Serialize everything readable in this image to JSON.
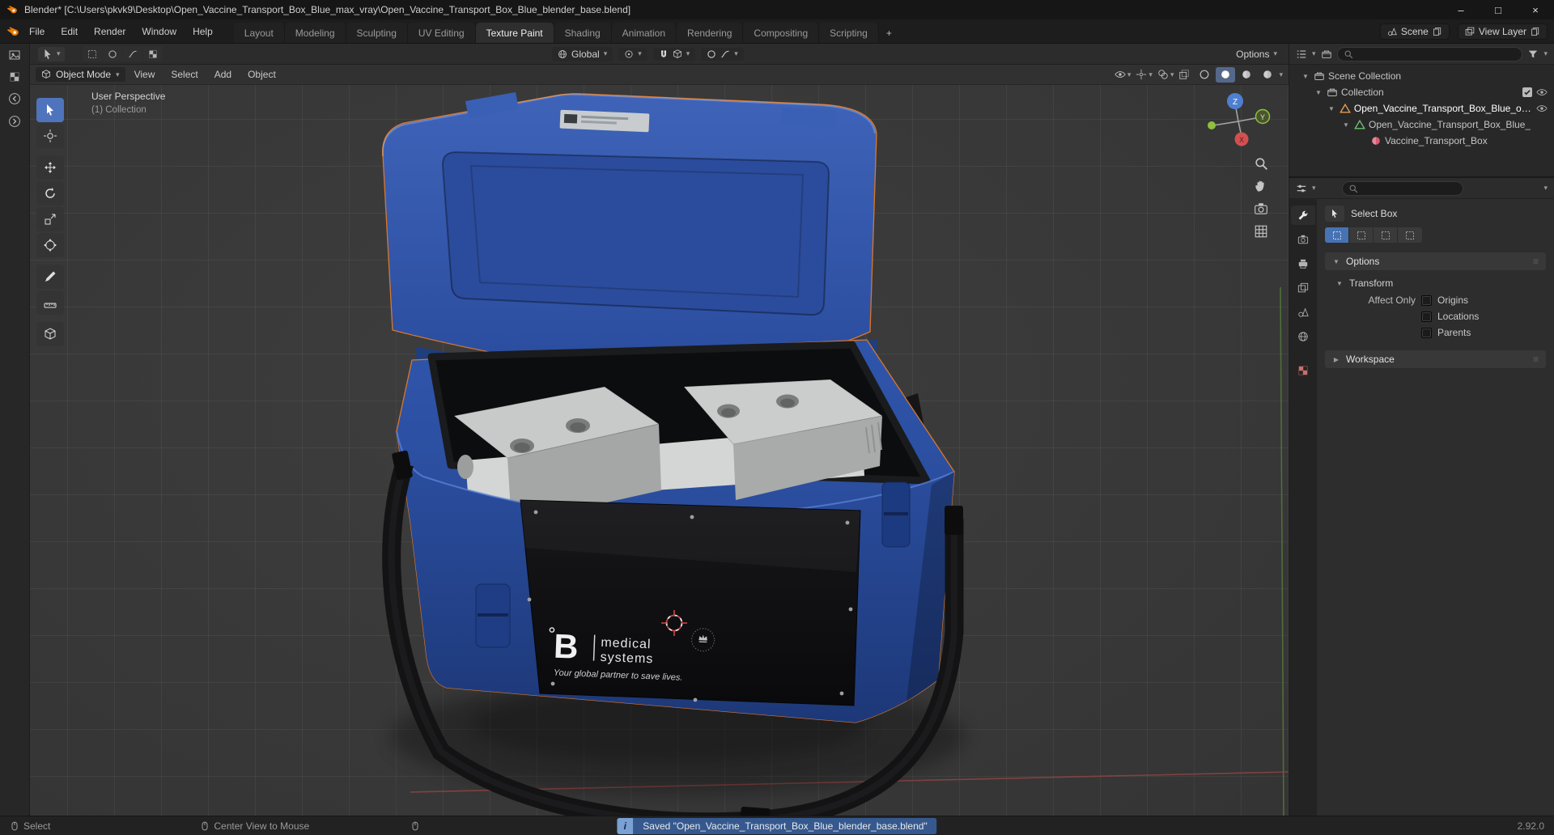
{
  "window": {
    "title": "Blender* [C:\\Users\\pkvk9\\Desktop\\Open_Vaccine_Transport_Box_Blue_max_vray\\Open_Vaccine_Transport_Box_Blue_blender_base.blend]",
    "minimize": "–",
    "maximize": "□",
    "close": "×"
  },
  "topbar": {
    "menus": [
      "File",
      "Edit",
      "Render",
      "Window",
      "Help"
    ],
    "tabs": [
      "Layout",
      "Modeling",
      "Sculpting",
      "UV Editing",
      "Texture Paint",
      "Shading",
      "Animation",
      "Rendering",
      "Compositing",
      "Scripting"
    ],
    "active_tab": "Texture Paint",
    "new_tab": "+",
    "scene": "Scene",
    "view_layer": "View Layer"
  },
  "tool_settings": {
    "orientation": "Global",
    "options": "Options"
  },
  "viewport": {
    "header": {
      "mode": "Object Mode",
      "menus": [
        "View",
        "Select",
        "Add",
        "Object"
      ]
    },
    "overlay": {
      "line1": "User Perspective",
      "line2": "(1) Collection"
    },
    "axis": {
      "x": "X",
      "y": "Y",
      "z": "Z"
    },
    "model": {
      "brand_letter": "B",
      "brand_line1": "medical",
      "brand_line2": "systems",
      "tagline": "Your global partner to save lives."
    }
  },
  "outliner": {
    "items": [
      {
        "label": "Scene Collection"
      },
      {
        "label": "Collection"
      },
      {
        "label": "Open_Vaccine_Transport_Box_Blue_obj_"
      },
      {
        "label": "Open_Vaccine_Transport_Box_Blue_"
      },
      {
        "label": "Vaccine_Transport_Box"
      }
    ]
  },
  "properties": {
    "tool_name": "Select Box",
    "panel_options": "Options",
    "panel_transform": "Transform",
    "affect_only": "Affect Only",
    "cb_origins": "Origins",
    "cb_locations": "Locations",
    "cb_parents": "Parents",
    "panel_workspace": "Workspace"
  },
  "statusbar": {
    "select": "Select",
    "center_view": "Center View to Mouse",
    "message": "Saved \"Open_Vaccine_Transport_Box_Blue_blender_base.blend\"",
    "version": "2.92.0"
  },
  "colors": {
    "accent": "#4772b3",
    "blender_orange": "#e87d0d",
    "box_blue": "#2e52a7",
    "info_blue": "#35598f"
  }
}
